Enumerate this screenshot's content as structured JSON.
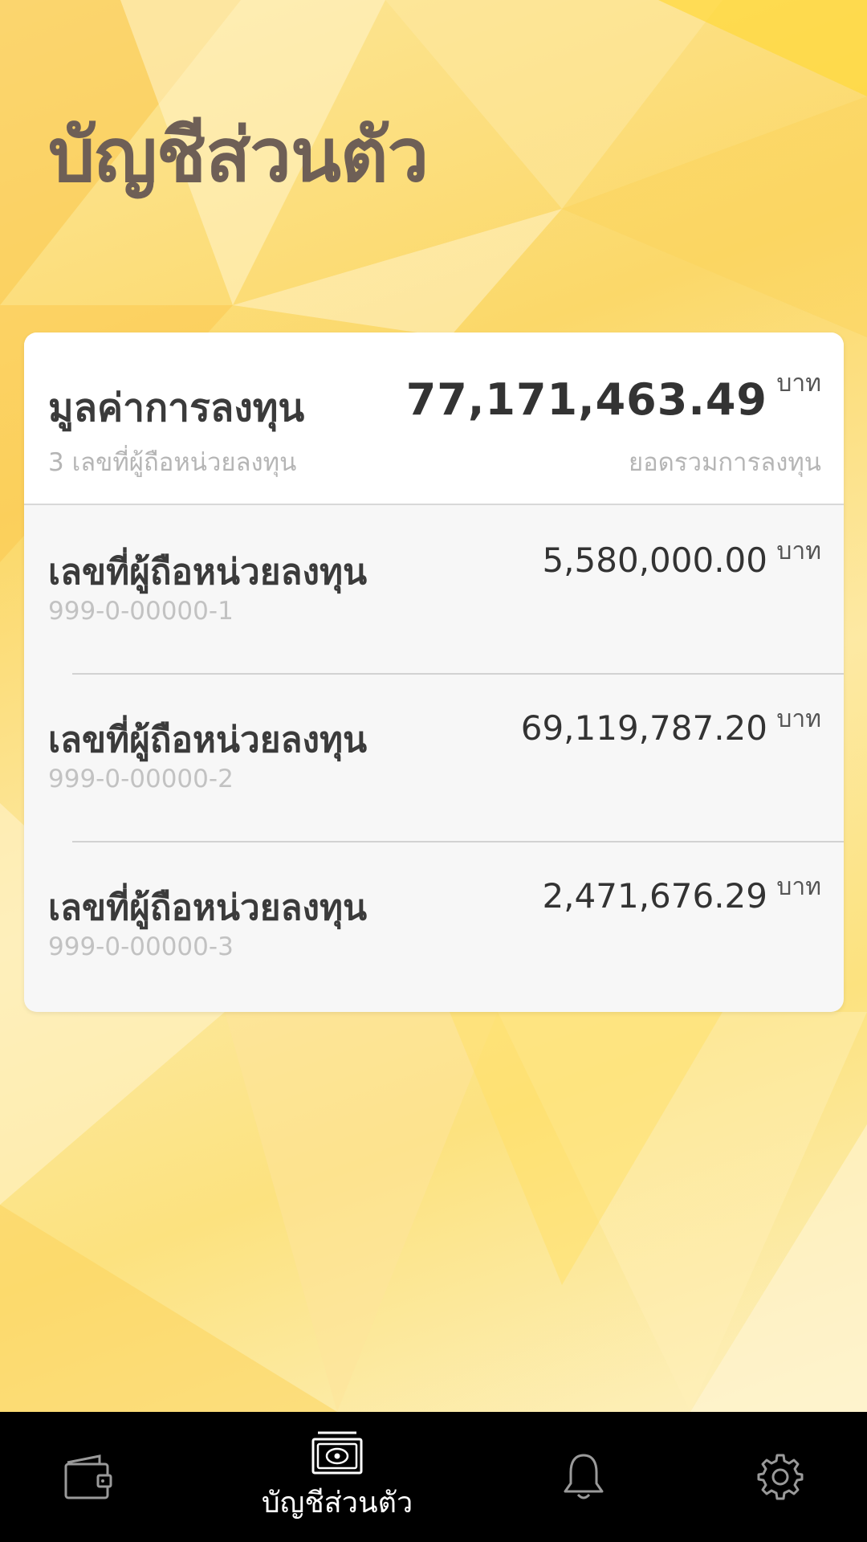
{
  "page": {
    "title": "บัญชีส่วนตัว"
  },
  "summary": {
    "title": "มูลค่าการลงทุน",
    "subtitle": "3 เลขที่ผู้ถือหน่วยลงทุน",
    "amount": "77,171,463.49",
    "unit": "บาท",
    "caption": "ยอดรวมการลงทุน"
  },
  "accounts": [
    {
      "label": "เลขที่ผู้ถือหน่วยลงทุน",
      "number": "999-0-00000-1",
      "amount": "5,580,000.00",
      "unit": "บาท"
    },
    {
      "label": "เลขที่ผู้ถือหน่วยลงทุน",
      "number": "999-0-00000-2",
      "amount": "69,119,787.20",
      "unit": "บาท"
    },
    {
      "label": "เลขที่ผู้ถือหน่วยลงทุน",
      "number": "999-0-00000-3",
      "amount": "2,471,676.29",
      "unit": "บาท"
    }
  ],
  "tabbar": {
    "items": [
      {
        "icon": "wallet-icon",
        "label": ""
      },
      {
        "icon": "money-icon",
        "label": "บัญชีส่วนตัว",
        "active": true
      },
      {
        "icon": "bell-icon",
        "label": ""
      },
      {
        "icon": "gear-icon",
        "label": ""
      }
    ]
  },
  "colors": {
    "title": "#6e5f56",
    "background": "#fbd869",
    "tabbar": "#000000"
  }
}
